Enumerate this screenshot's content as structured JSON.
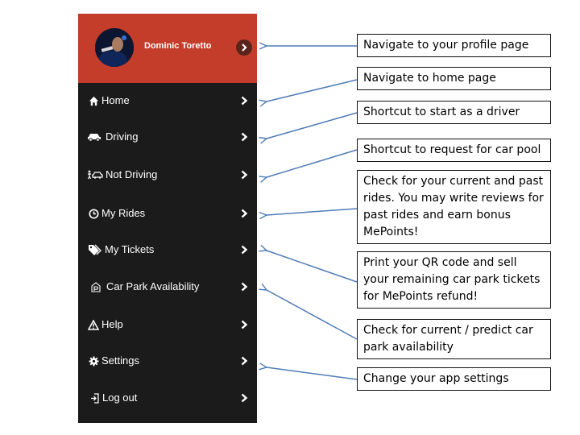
{
  "profile": {
    "name": "Dominic Toretto"
  },
  "menu": {
    "items": [
      {
        "label": "Home",
        "icon": "home-icon"
      },
      {
        "label": "Driving",
        "icon": "car-icon"
      },
      {
        "label": "Not Driving",
        "icon": "pedestrian-car-icon"
      },
      {
        "label": "My Rides",
        "icon": "clock-icon"
      },
      {
        "label": "My Tickets",
        "icon": "tags-icon"
      },
      {
        "label": "Car Park Availability",
        "icon": "parking-icon"
      },
      {
        "label": "Help",
        "icon": "warning-icon"
      },
      {
        "label": "Settings",
        "icon": "gear-icon"
      },
      {
        "label": "Log out",
        "icon": "logout-icon"
      }
    ]
  },
  "callouts": [
    "Navigate to your profile page",
    "Navigate to home page",
    "Shortcut to start as a driver",
    "Shortcut to request for car pool",
    "Check for your current and past rides. You may write reviews for past rides and earn bonus MePoints!",
    "Print your QR code and sell your remaining car park tickets for MePoints refund!",
    "Check for current / predict car park availability",
    "Change your app settings"
  ],
  "colors": {
    "header": "#c33d2a",
    "menu_bg": "#1b1b1b",
    "arrow": "#4f7cb7"
  }
}
